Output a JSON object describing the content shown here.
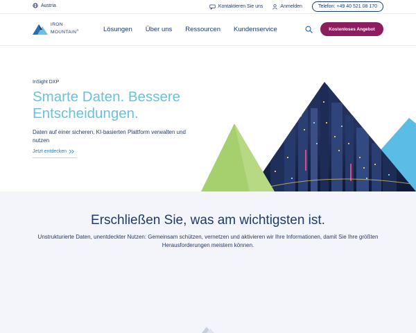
{
  "utility": {
    "region": "Austria",
    "contact": "Kontaktieren Sie uns",
    "login": "Anmelden",
    "phone": "Telefon: +49 40 521 08 170"
  },
  "nav": {
    "logo_line1": "IRON",
    "logo_line2": "MOUNTAIN",
    "logo_mark": "®",
    "items": [
      "Lösungen",
      "Über uns",
      "Ressourcen",
      "Kundenservice"
    ],
    "cta": "Kostenloses Angebot"
  },
  "hero": {
    "eyebrow": "InSight DXP",
    "headline": "Smarte Daten. Bessere Entscheidungen.",
    "subtext": "Daten auf einer sicheren, KI-basierten Plattform verwalten und nutzen",
    "link": "Jetzt entdecken"
  },
  "section": {
    "title": "Erschließen Sie, was am wichtigsten ist.",
    "text": "Unstrukturierte Daten, unentdeckter Nutzen: Gemeinsam schützen, vernetzen und aktivieren wir Ihre Informationen, damit Sie Ihre größten Herausforderungen meistern können."
  },
  "colors": {
    "navy": "#1d3a6b",
    "headline_blue": "#6bc0de",
    "cta_magenta": "#8c1e5f",
    "section_bg": "#f3f5fa",
    "green_triangle": "#a6cf6e",
    "blue_triangle": "#5bbde6"
  },
  "icons": [
    "globe-icon",
    "chat-icon",
    "user-icon",
    "search-icon",
    "chevron-right-icon"
  ]
}
